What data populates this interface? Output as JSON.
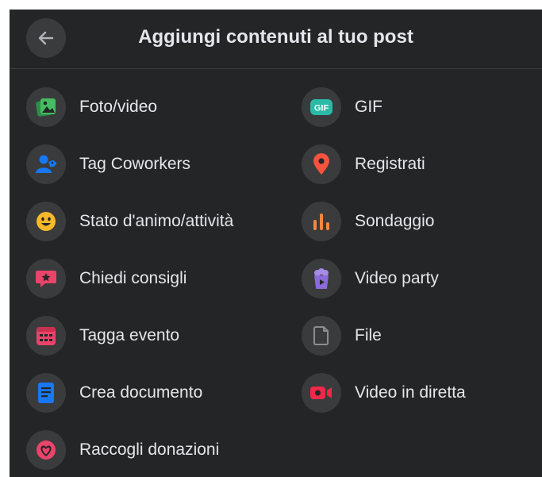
{
  "header": {
    "title": "Aggiungi contenuti al tuo post",
    "back_icon": "arrow-left-icon"
  },
  "colors": {
    "panel_bg": "#242526",
    "icon_bg": "#3a3b3c",
    "text": "#e4e6eb",
    "green": "#45bd62",
    "blue": "#1877f2",
    "yellow": "#f7b928",
    "pink": "#e9446a",
    "red": "#f5533d",
    "orange": "#f5873d",
    "purple": "#8b6bd7",
    "teal": "#2abba7"
  },
  "options": {
    "left": [
      {
        "label": "Foto/video",
        "icon": "photo-video-icon"
      },
      {
        "label": "Tag Coworkers",
        "icon": "tag-people-icon"
      },
      {
        "label": "Stato d'animo/attività",
        "icon": "smiley-icon"
      },
      {
        "label": "Chiedi consigli",
        "icon": "speech-bubble-star-icon"
      },
      {
        "label": "Tagga evento",
        "icon": "calendar-icon"
      },
      {
        "label": "Crea documento",
        "icon": "document-icon"
      },
      {
        "label": "Raccogli donazioni",
        "icon": "heart-donation-icon"
      }
    ],
    "right": [
      {
        "label": "GIF",
        "icon": "gif-icon",
        "icon_text": "GIF"
      },
      {
        "label": "Registrati",
        "icon": "location-pin-icon"
      },
      {
        "label": "Sondaggio",
        "icon": "poll-icon"
      },
      {
        "label": "Video party",
        "icon": "popcorn-icon"
      },
      {
        "label": "File",
        "icon": "file-icon"
      },
      {
        "label": "Video in diretta",
        "icon": "live-video-icon"
      }
    ]
  }
}
